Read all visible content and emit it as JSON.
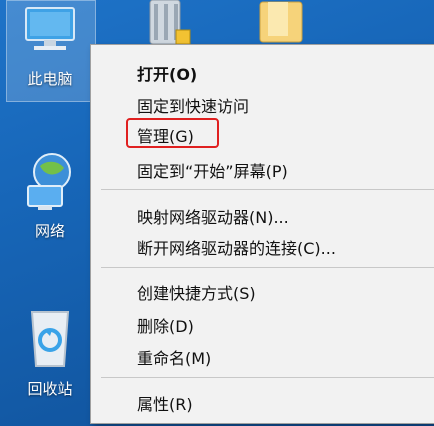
{
  "desktop": {
    "icons": [
      {
        "name": "此电脑"
      },
      {
        "name": "网络"
      },
      {
        "name": "回收站"
      }
    ]
  },
  "context_menu": {
    "items": [
      {
        "label": "打开(O)",
        "bold": true
      },
      {
        "label": "固定到快速访问"
      },
      {
        "label": "管理(G)",
        "highlighted": true
      },
      {
        "label": "固定到“开始”屏幕(P)"
      },
      {
        "label": "映射网络驱动器(N)..."
      },
      {
        "label": "断开网络驱动器的连接(C)..."
      },
      {
        "label": "创建快捷方式(S)"
      },
      {
        "label": "删除(D)"
      },
      {
        "label": "重命名(M)"
      },
      {
        "label": "属性(R)"
      }
    ]
  },
  "colors": {
    "highlight_box": "#e02020",
    "desktop_bg": "#1766b8",
    "menu_bg": "#f2f2f2"
  }
}
